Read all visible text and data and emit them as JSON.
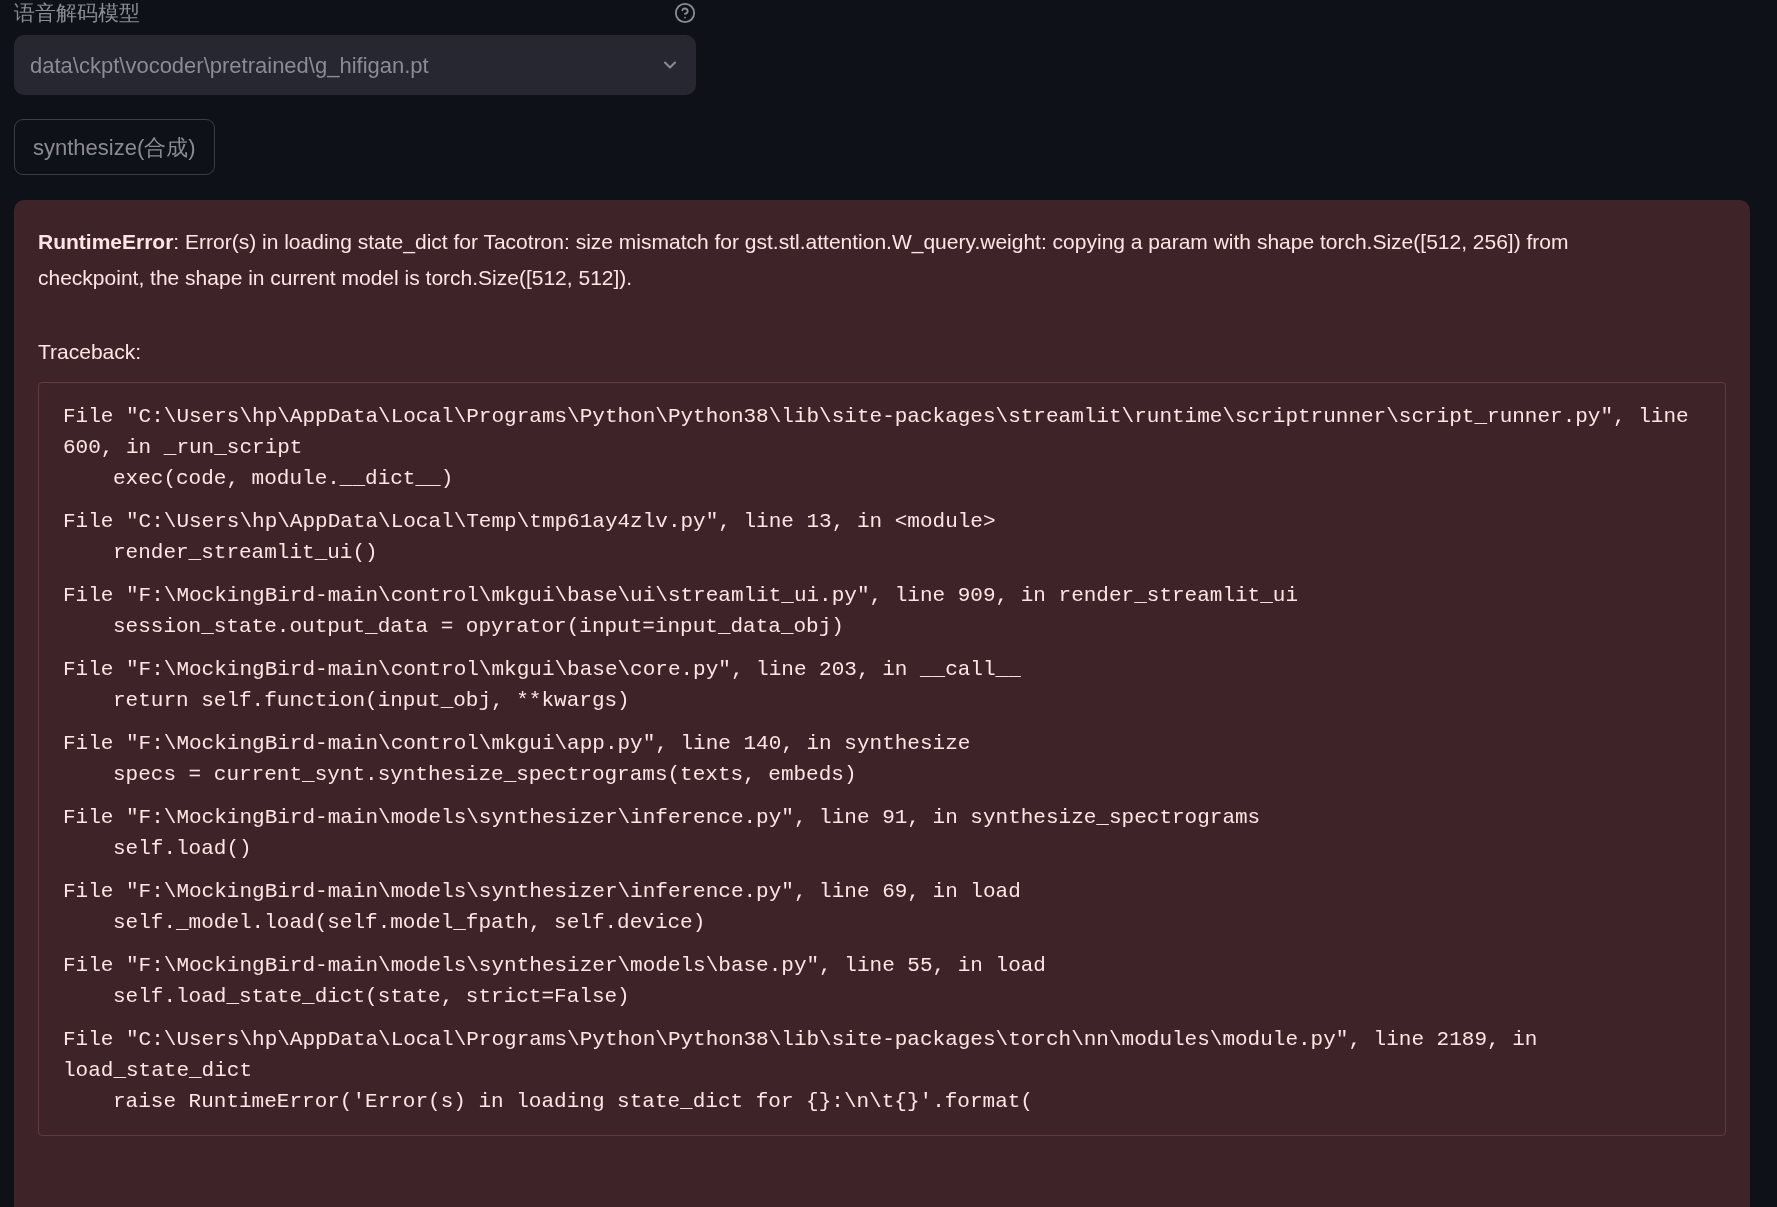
{
  "field": {
    "label": "语音解码模型",
    "value": "data\\ckpt\\vocoder\\pretrained\\g_hifigan.pt"
  },
  "button": {
    "label": "synthesize(合成)"
  },
  "error": {
    "title": "RuntimeError",
    "message": ": Error(s) in loading state_dict for Tacotron: size mismatch for gst.stl.attention.W_query.weight: copying a param with shape torch.Size([512, 256]) from checkpoint, the shape in current model is torch.Size([512, 512]).",
    "traceback_label": "Traceback:",
    "frames": [
      {
        "location": "File \"C:\\Users\\hp\\AppData\\Local\\Programs\\Python\\Python38\\lib\\site-packages\\streamlit\\runtime\\scriptrunner\\script_runner.py\", line 600, in _run_script",
        "code": "exec(code, module.__dict__)"
      },
      {
        "location": "File \"C:\\Users\\hp\\AppData\\Local\\Temp\\tmp61ay4zlv.py\", line 13, in <module>",
        "code": "render_streamlit_ui()"
      },
      {
        "location": "File \"F:\\MockingBird-main\\control\\mkgui\\base\\ui\\streamlit_ui.py\", line 909, in render_streamlit_ui",
        "code": "session_state.output_data = opyrator(input=input_data_obj)"
      },
      {
        "location": "File \"F:\\MockingBird-main\\control\\mkgui\\base\\core.py\", line 203, in __call__",
        "code": "return self.function(input_obj, **kwargs)"
      },
      {
        "location": "File \"F:\\MockingBird-main\\control\\mkgui\\app.py\", line 140, in synthesize",
        "code": "specs = current_synt.synthesize_spectrograms(texts, embeds)"
      },
      {
        "location": "File \"F:\\MockingBird-main\\models\\synthesizer\\inference.py\", line 91, in synthesize_spectrograms",
        "code": "self.load()"
      },
      {
        "location": "File \"F:\\MockingBird-main\\models\\synthesizer\\inference.py\", line 69, in load",
        "code": "self._model.load(self.model_fpath, self.device)"
      },
      {
        "location": "File \"F:\\MockingBird-main\\models\\synthesizer\\models\\base.py\", line 55, in load",
        "code": "self.load_state_dict(state, strict=False)"
      },
      {
        "location": "File \"C:\\Users\\hp\\AppData\\Local\\Programs\\Python\\Python38\\lib\\site-packages\\torch\\nn\\modules\\module.py\", line 2189, in load_state_dict",
        "code": "raise RuntimeError('Error(s) in loading state_dict for {}:\\n\\t{}'.format("
      }
    ]
  }
}
